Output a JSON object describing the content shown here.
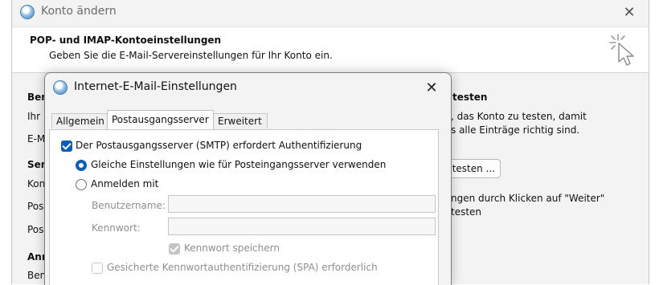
{
  "outer_window": {
    "title": "Konto ändern",
    "close_glyph": "✕",
    "header": {
      "title": "POP- und IMAP-Kontoeinstellungen",
      "subtitle": "Geben Sie die E-Mail-Servereinstellungen für Ihr Konto ein."
    },
    "left_fragments": [
      "Ben",
      "Ihr N",
      "E-M",
      "Ser",
      "Kon",
      "Pos",
      "Pos",
      "Anr",
      "Ben"
    ],
    "right_fragments": {
      "heading": "testen",
      "line1": ", das Konto zu testen, damit",
      "line2": "s alle Einträge richtig sind.",
      "test_button": "testen ...",
      "note1": "ngen durch Klicken auf \"Weiter\"",
      "note2": "testen"
    }
  },
  "dialog": {
    "title": "Internet-E-Mail-Einstellungen",
    "close_glyph": "✕",
    "tabs": [
      {
        "label": "Allgemein",
        "active": false
      },
      {
        "label": "Postausgangsserver",
        "active": true
      },
      {
        "label": "Erweitert",
        "active": false
      }
    ],
    "smtp_auth": {
      "label": "Der Postausgangsserver (SMTP) erfordert Authentifizierung",
      "checked": true
    },
    "radio_same": {
      "label": "Gleiche Einstellungen wie für Posteingangsserver verwenden",
      "selected": true
    },
    "radio_login": {
      "label": "Anmelden mit",
      "selected": false
    },
    "username": {
      "label": "Benutzername:",
      "value": ""
    },
    "password": {
      "label": "Kennwort:",
      "value": ""
    },
    "remember_password": {
      "label": "Kennwort speichern",
      "checked": true,
      "enabled": false
    },
    "spa": {
      "label": "Gesicherte Kennwortauthentifizierung (SPA) erforderlich",
      "checked": false,
      "enabled": false
    }
  },
  "colors": {
    "accent": "#0a5fb4",
    "window_bg": "#f3f3f3",
    "panel_bg": "#ffffff"
  },
  "icons": {
    "app_icon": "outlook-globe-icon",
    "wizard_icon": "sparkle-cursor-icon"
  }
}
